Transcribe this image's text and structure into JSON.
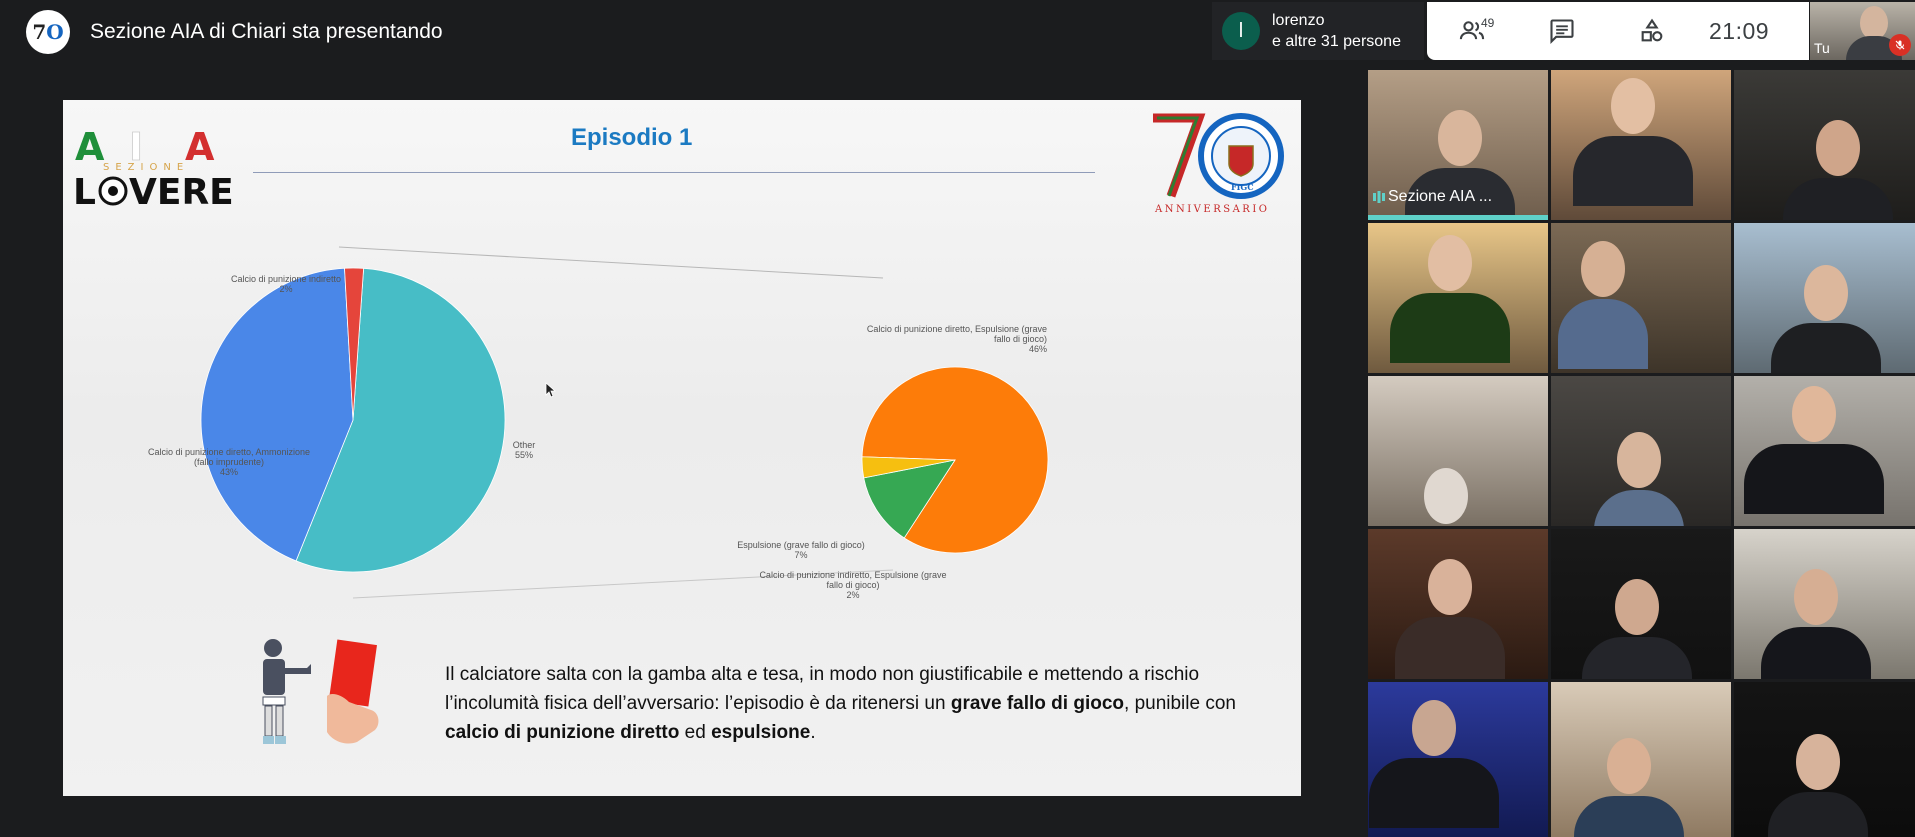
{
  "topbar": {
    "presenting_title": "Sezione AIA di Chiari sta presentando",
    "participant_avatar_letter": "l",
    "participant_name": "lorenzo",
    "participant_others": "e altre 31 persone",
    "people_count": "49",
    "clock": "21:09",
    "self_label": "Tu"
  },
  "slide": {
    "title": "Episodio 1",
    "logo_left_top": "AIA",
    "logo_left_sub": "SEZIONE",
    "logo_left_bottom": "LOVERE",
    "logo_right_number": "70",
    "logo_right_text": "ANNIVERSARIO",
    "logo_right_badge": "FIGC",
    "body_parts": {
      "p1": "Il calciatore salta con la gamba alta e tesa, in modo non giustificabile e mettendo a rischio l’incolumità fisica dell’avversario: l’episodio è da ritenersi un ",
      "b1": "grave fallo di gioco",
      "p2": ", punibile con ",
      "b2": "calcio di punizione diretto",
      "p3": " ed ",
      "b3": "espulsione",
      "p4": "."
    }
  },
  "chart_data": {
    "type": "pie",
    "subtype": "pie-of-pie",
    "main_pie": {
      "slices": [
        {
          "label": "Other",
          "percent_label": "55%",
          "value": 55,
          "color": "#47bdc6"
        },
        {
          "label": "Calcio di punizione diretto, Ammonizione (fallo imprudente)",
          "percent_label": "43%",
          "value": 43,
          "color": "#4a87e8"
        },
        {
          "label": "Calcio di punizione indiretto",
          "percent_label": "2%",
          "value": 2,
          "color": "#e5453b"
        }
      ]
    },
    "secondary_pie": {
      "slices": [
        {
          "label": "Calcio di punizione diretto, Espulsione (grave fallo di gioco)",
          "percent_label": "46%",
          "value": 46,
          "color": "#fd7c09"
        },
        {
          "label": "Espulsione (grave fallo di gioco)",
          "percent_label": "7%",
          "value": 7,
          "color": "#36a853"
        },
        {
          "label": "Calcio di punizione indiretto, Espulsione (grave fallo di gioco)",
          "percent_label": "2%",
          "value": 2,
          "color": "#f6bf10"
        }
      ]
    }
  },
  "grid": {
    "speaking_tile_name": "Sezione AIA ..."
  }
}
